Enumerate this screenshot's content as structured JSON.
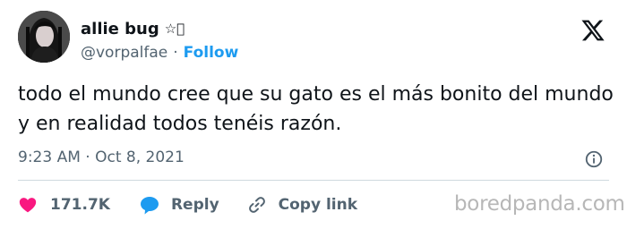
{
  "author": {
    "display_name": "allie bug",
    "name_emoji": "☆🏻",
    "handle": "@vorpalfae",
    "separator": "·",
    "follow_label": "Follow"
  },
  "tweet": {
    "text": "todo el mundo cree que su gato es el más bonito del mundo y en realidad todos tenéis razón.",
    "timestamp": "9:23 AM · Oct 8, 2021"
  },
  "actions": {
    "like_count": "171.7K",
    "reply_label": "Reply",
    "copy_label": "Copy link"
  },
  "watermark": "boredpanda.com",
  "colors": {
    "text": "#0f1419",
    "secondary": "#536471",
    "link": "#1d9bf0",
    "like": "#f91880",
    "divider": "#cfd9de",
    "watermark": "#b7b7b7"
  },
  "icons": {
    "brand": "x-logo-icon",
    "info": "info-icon",
    "like": "heart-icon",
    "reply": "speech-bubble-icon",
    "copy": "link-icon"
  }
}
